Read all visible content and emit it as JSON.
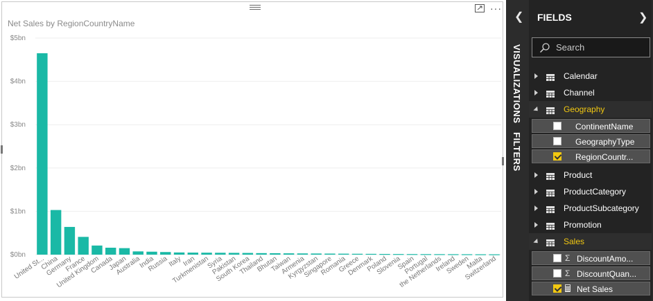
{
  "visual": {
    "title": "Net Sales by RegionCountryName",
    "more_label": "···"
  },
  "chart_data": {
    "type": "bar",
    "title": "Net Sales by RegionCountryName",
    "xlabel": "",
    "ylabel": "",
    "ylim": [
      0,
      5000000000
    ],
    "y_ticks": [
      "$0bn",
      "$1bn",
      "$2bn",
      "$3bn",
      "$4bn",
      "$5bn"
    ],
    "bar_color": "#1ab9a6",
    "categories": [
      "United St...",
      "China",
      "Germany",
      "France",
      "United Kingdom",
      "Canada",
      "Japan",
      "Australia",
      "India",
      "Russia",
      "Italy",
      "Iran",
      "Turkmenistan",
      "Syria",
      "Pakistan",
      "South Korea",
      "Thailand",
      "Bhutan",
      "Taiwan",
      "Armenia",
      "Kyrgyzstan",
      "Singapore",
      "Romania",
      "Greece",
      "Denmark",
      "Poland",
      "Slovenia",
      "Spain",
      "Portugal",
      "the Netherlands",
      "Ireland",
      "Sweden",
      "Malta",
      "Switzerland"
    ],
    "values": [
      4650000000,
      1030000000,
      640000000,
      410000000,
      210000000,
      160000000,
      150000000,
      75000000,
      68000000,
      60000000,
      50000000,
      47000000,
      45000000,
      43000000,
      41000000,
      39000000,
      35000000,
      33000000,
      30000000,
      28000000,
      26000000,
      24000000,
      22000000,
      20000000,
      18000000,
      16000000,
      14000000,
      13000000,
      12000000,
      11000000,
      10000000,
      9000000,
      8000000,
      7000000
    ],
    "grid": true,
    "legend": "none"
  },
  "strip": {
    "visualizations_label": "VISUALIZATIONS",
    "filters_label": "FILTERS"
  },
  "fields": {
    "header": "FIELDS",
    "search_placeholder": "Search",
    "accent_color": "#f2c811",
    "tables": [
      {
        "label": "Calendar"
      },
      {
        "label": "Channel"
      },
      {
        "label": "Geography",
        "expanded": true,
        "fields": [
          {
            "label": "ContinentName",
            "checked": false
          },
          {
            "label": "GeographyType",
            "checked": false
          },
          {
            "label": "RegionCountr...",
            "checked": true
          }
        ]
      },
      {
        "label": "Product"
      },
      {
        "label": "ProductCategory"
      },
      {
        "label": "ProductSubcategory"
      },
      {
        "label": "Promotion"
      },
      {
        "label": "Sales",
        "expanded": true,
        "fields": [
          {
            "label": "DiscountAmo...",
            "checked": false,
            "icon": "sigma-icon"
          },
          {
            "label": "DiscountQuan...",
            "checked": false,
            "icon": "sigma-icon"
          },
          {
            "label": "Net Sales",
            "checked": true,
            "icon": "calculator-icon"
          }
        ]
      }
    ]
  }
}
